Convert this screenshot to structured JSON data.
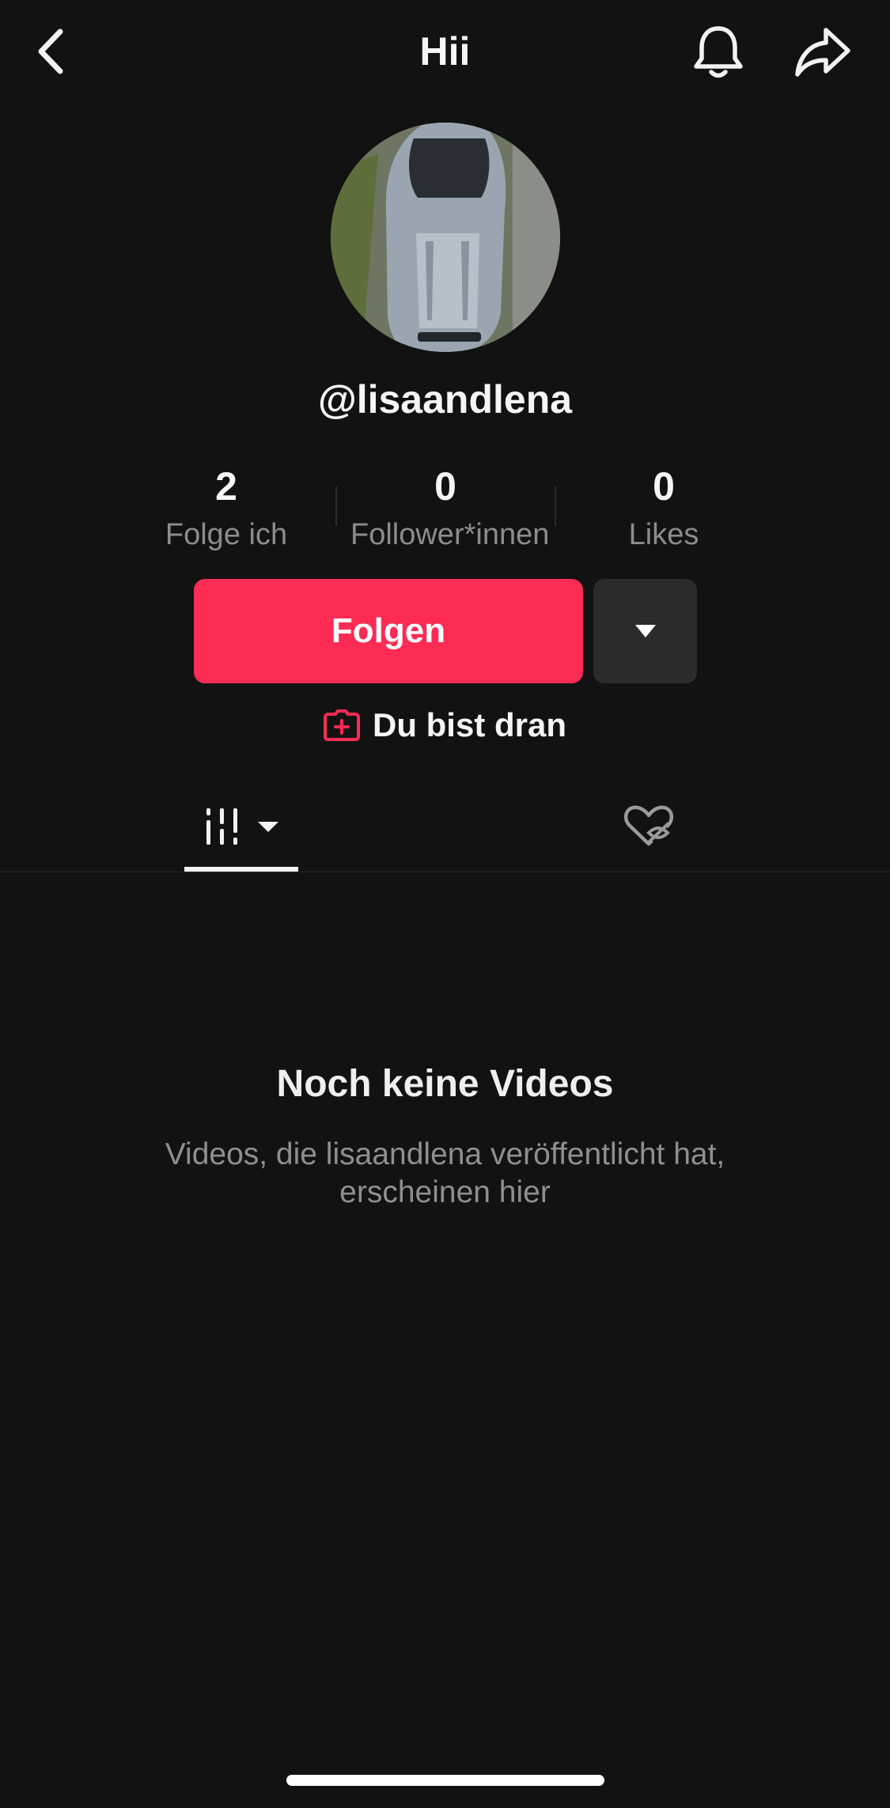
{
  "header": {
    "title": "Hii",
    "back_icon": "chevron-left-icon",
    "bell_icon": "bell-icon",
    "share_icon": "share-arrow-icon"
  },
  "profile": {
    "avatar": "car-photo-avatar",
    "username": "@lisaandlena"
  },
  "stats": [
    {
      "value": "2",
      "label": "Folge ich"
    },
    {
      "value": "0",
      "label": "Follower*innen"
    },
    {
      "value": "0",
      "label": "Likes"
    }
  ],
  "actions": {
    "follow_label": "Folgen",
    "dropdown_icon": "caret-down-icon",
    "your_turn_label": "Du bist dran",
    "your_turn_icon": "camera-plus-icon"
  },
  "tabs": {
    "videos_icon": "grid-bars-icon",
    "videos_selected": true,
    "liked_icon": "heart-hidden-icon"
  },
  "empty_state": {
    "title": "Noch keine Videos",
    "description": "Videos, die lisaandlena veröffentlicht hat, erscheinen hier"
  },
  "colors": {
    "background": "#121212",
    "accent": "#fe2c55",
    "secondary_button": "#2b2b2b",
    "muted_text": "#8f8f8f"
  }
}
